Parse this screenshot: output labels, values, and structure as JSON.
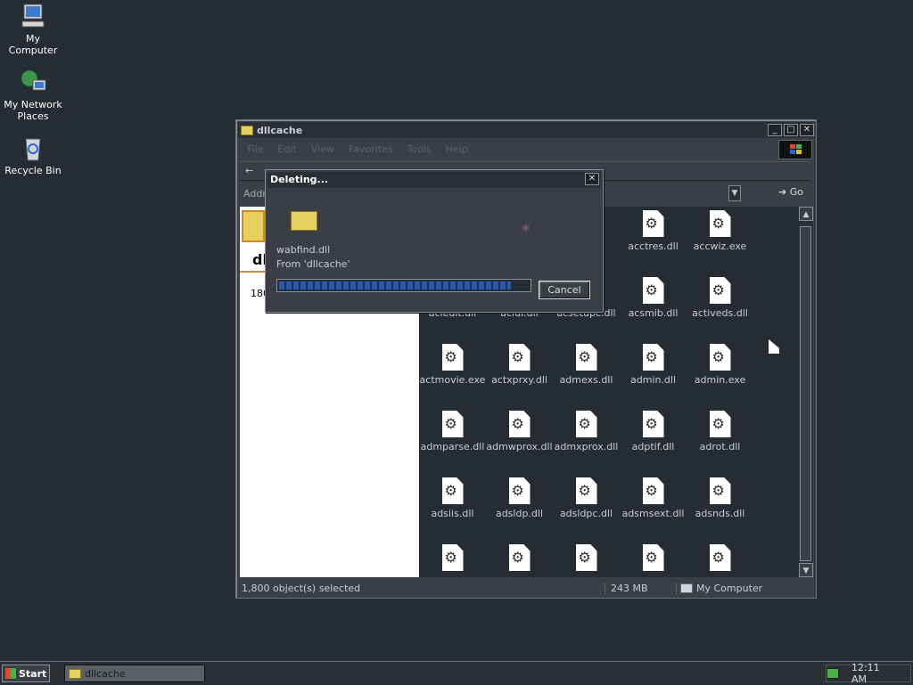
{
  "desktop": {
    "icons": [
      {
        "label": "My Computer"
      },
      {
        "label": "My Network\nPlaces"
      },
      {
        "label": "Recycle Bin"
      }
    ]
  },
  "window": {
    "title": "dllcache",
    "menu": [
      "File",
      "Edit",
      "View",
      "Favorites",
      "Tools",
      "Help"
    ],
    "address_label": "Addre",
    "go_label": "Go",
    "left_pane": {
      "folder_title": "dll",
      "count_text": "180"
    },
    "files": [
      {
        "name": "acctres.dll"
      },
      {
        "name": "accwiz.exe"
      },
      {
        "name": "acledit.dll"
      },
      {
        "name": "aclui.dll"
      },
      {
        "name": "acsetupc.dll"
      },
      {
        "name": "acsmib.dll"
      },
      {
        "name": "activeds.dll"
      },
      {
        "name": "actmovie.exe"
      },
      {
        "name": "actxprxy.dll"
      },
      {
        "name": "admexs.dll"
      },
      {
        "name": "admin.dll"
      },
      {
        "name": "admin.exe"
      },
      {
        "name": "admparse.dll"
      },
      {
        "name": "admwprox.dll"
      },
      {
        "name": "admxprox.dll"
      },
      {
        "name": "adptif.dll"
      },
      {
        "name": "adrot.dll"
      },
      {
        "name": "adsiis.dll"
      },
      {
        "name": "adsldp.dll"
      },
      {
        "name": "adsldpc.dll"
      },
      {
        "name": "adsmsext.dll"
      },
      {
        "name": "adsnds.dll"
      }
    ],
    "status": {
      "selected": "1,800 object(s) selected",
      "size": "243 MB",
      "zone": "My Computer"
    }
  },
  "dialog": {
    "title": "Deleting...",
    "file_name": "wabfind.dll",
    "from_text": "From 'dllcache'",
    "progress": 0.93,
    "cancel_label": "Cancel"
  },
  "taskbar": {
    "start_label": "Start",
    "task_label": "dllcache",
    "clock": "12:11 AM"
  }
}
